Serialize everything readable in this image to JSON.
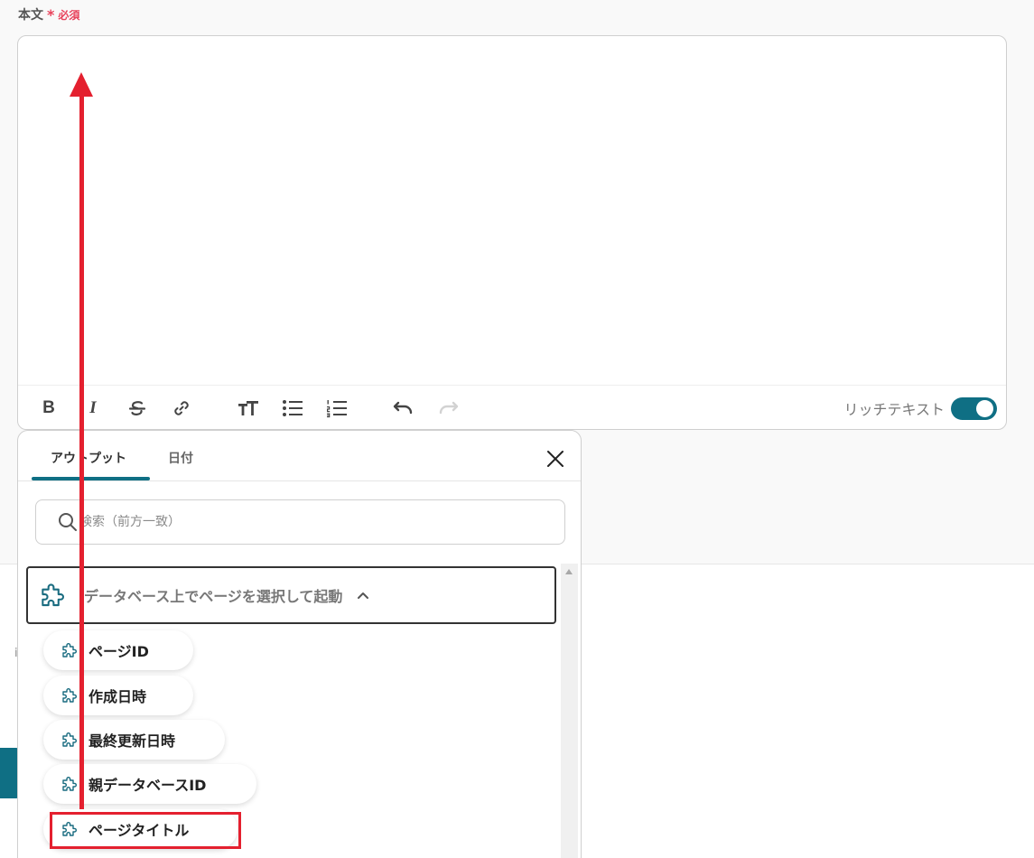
{
  "field": {
    "label": "本文",
    "required_star": "*",
    "required_text": "必須"
  },
  "toolbar": {
    "bold_glyph": "B",
    "italic_glyph": "I",
    "rich_text_label": "リッチテキスト",
    "rich_text_enabled": true
  },
  "panel": {
    "tabs": [
      {
        "label": "アウトプット",
        "active": true
      },
      {
        "label": "日付",
        "active": false
      }
    ],
    "search_placeholder": "検索（前方一致）",
    "group_label": "データベース上でページを選択して起動",
    "items": [
      {
        "label": "ページID"
      },
      {
        "label": "作成日時"
      },
      {
        "label": "最終更新日時"
      },
      {
        "label": "親データベースID"
      },
      {
        "label": "ページタイトル"
      }
    ]
  },
  "colors": {
    "accent": "#0f6f84",
    "required": "#e8425b",
    "annotation": "#e4202f"
  },
  "icons": {
    "search": "search-icon",
    "close": "close-icon",
    "group": "puzzle-icon",
    "caret": "chevron-up-icon"
  }
}
